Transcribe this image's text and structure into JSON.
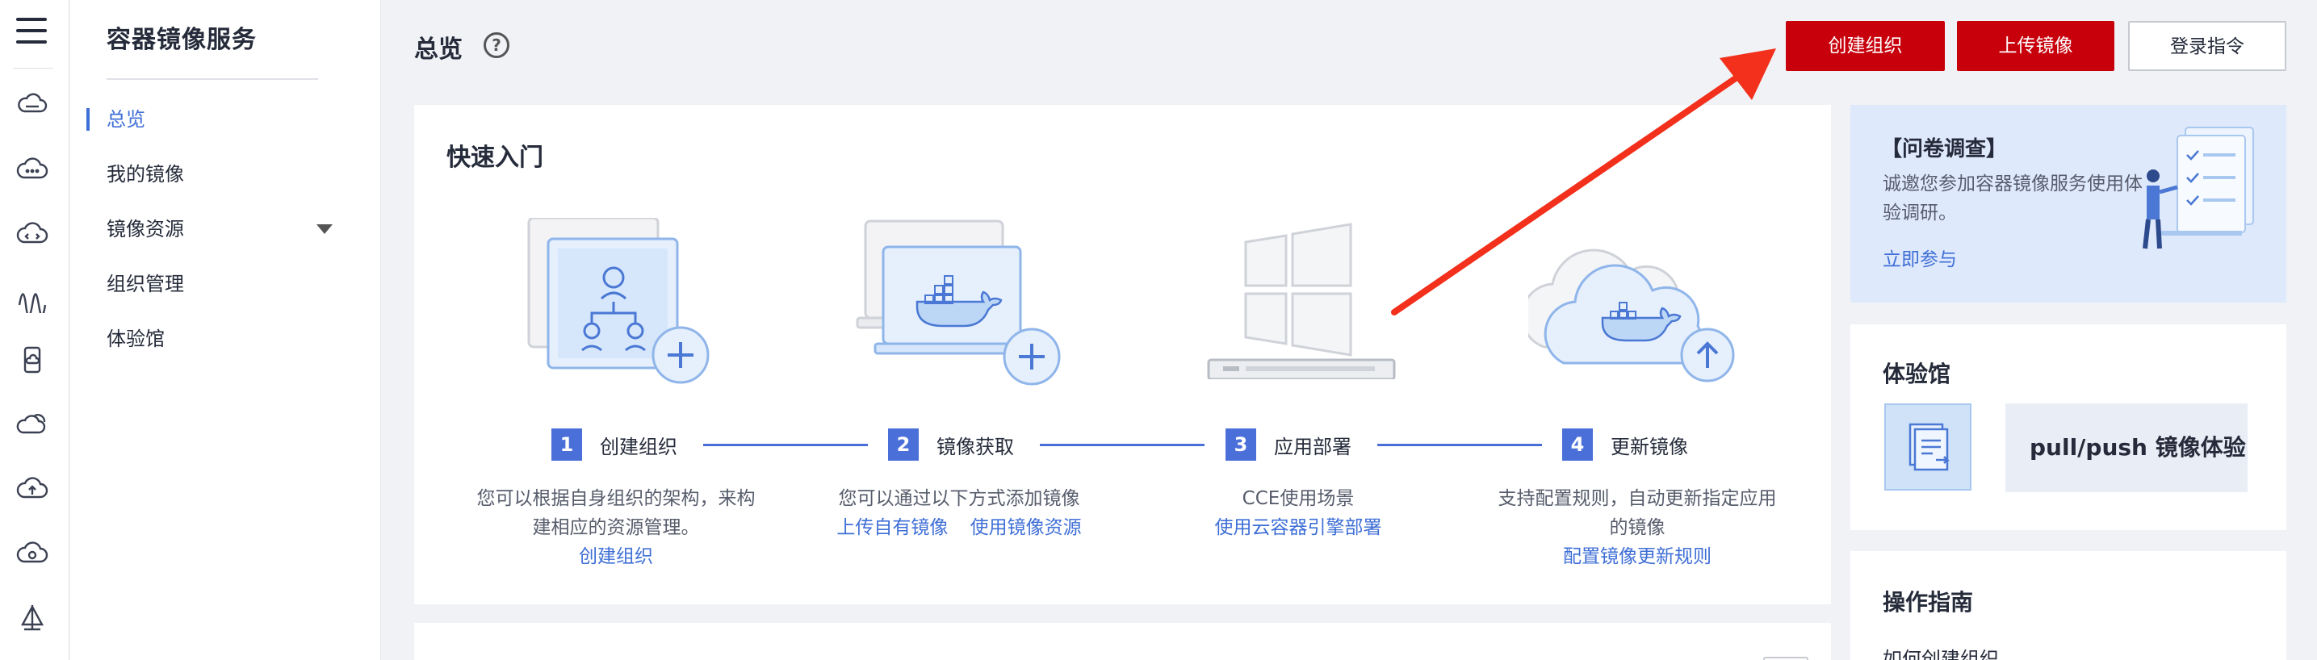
{
  "rail": {
    "items": [
      "menu-icon",
      "cloud-disk-icon",
      "cloud-dots-icon",
      "cloud-code-icon",
      "wave-icon",
      "phone-cloud-icon",
      "cloud-double-icon",
      "cloud-upload-icon",
      "cloud-loop-icon",
      "sail-icon"
    ]
  },
  "sidebar": {
    "title": "容器镜像服务",
    "items": [
      {
        "label": "总览",
        "active": true
      },
      {
        "label": "我的镜像"
      },
      {
        "label": "镜像资源",
        "expandable": true
      },
      {
        "label": "组织管理"
      },
      {
        "label": "体验馆"
      }
    ]
  },
  "header": {
    "title": "总览",
    "help": "?",
    "buttons": {
      "create_org": "创建组织",
      "upload_image": "上传镜像",
      "login_cmd": "登录指令"
    }
  },
  "quickstart": {
    "title": "快速入门",
    "steps": [
      {
        "num": "1",
        "label": "创建组织",
        "desc": [
          "您可以根据自身组织的架构，来构",
          "建相应的资源管理。"
        ],
        "links": [
          "创建组织"
        ]
      },
      {
        "num": "2",
        "label": "镜像获取",
        "desc": [
          "您可以通过以下方式添加镜像"
        ],
        "links": [
          "上传自有镜像",
          "使用镜像资源"
        ]
      },
      {
        "num": "3",
        "label": "应用部署",
        "desc": [
          "CCE使用场景"
        ],
        "links": [
          "使用云容器引擎部署"
        ]
      },
      {
        "num": "4",
        "label": "更新镜像",
        "desc": [
          "支持配置规则，自动更新指定应用",
          "的镜像"
        ],
        "links": [
          "配置镜像更新规则"
        ]
      }
    ]
  },
  "survey": {
    "title": "【问卷调查】",
    "text": "诚邀您参加容器镜像服务使用体验调研。",
    "link": "立即参与"
  },
  "experience": {
    "title": "体验馆",
    "tile_label": "pull/push 镜像体验"
  },
  "guide": {
    "title": "操作指南",
    "first_item": "如何创建组织"
  },
  "colors": {
    "accent": "#3f6fd6",
    "step": "#4a6fd9",
    "primary_button": "#c7000b",
    "arrow": "#f2301b",
    "survey_bg": "#dfe9fc"
  }
}
